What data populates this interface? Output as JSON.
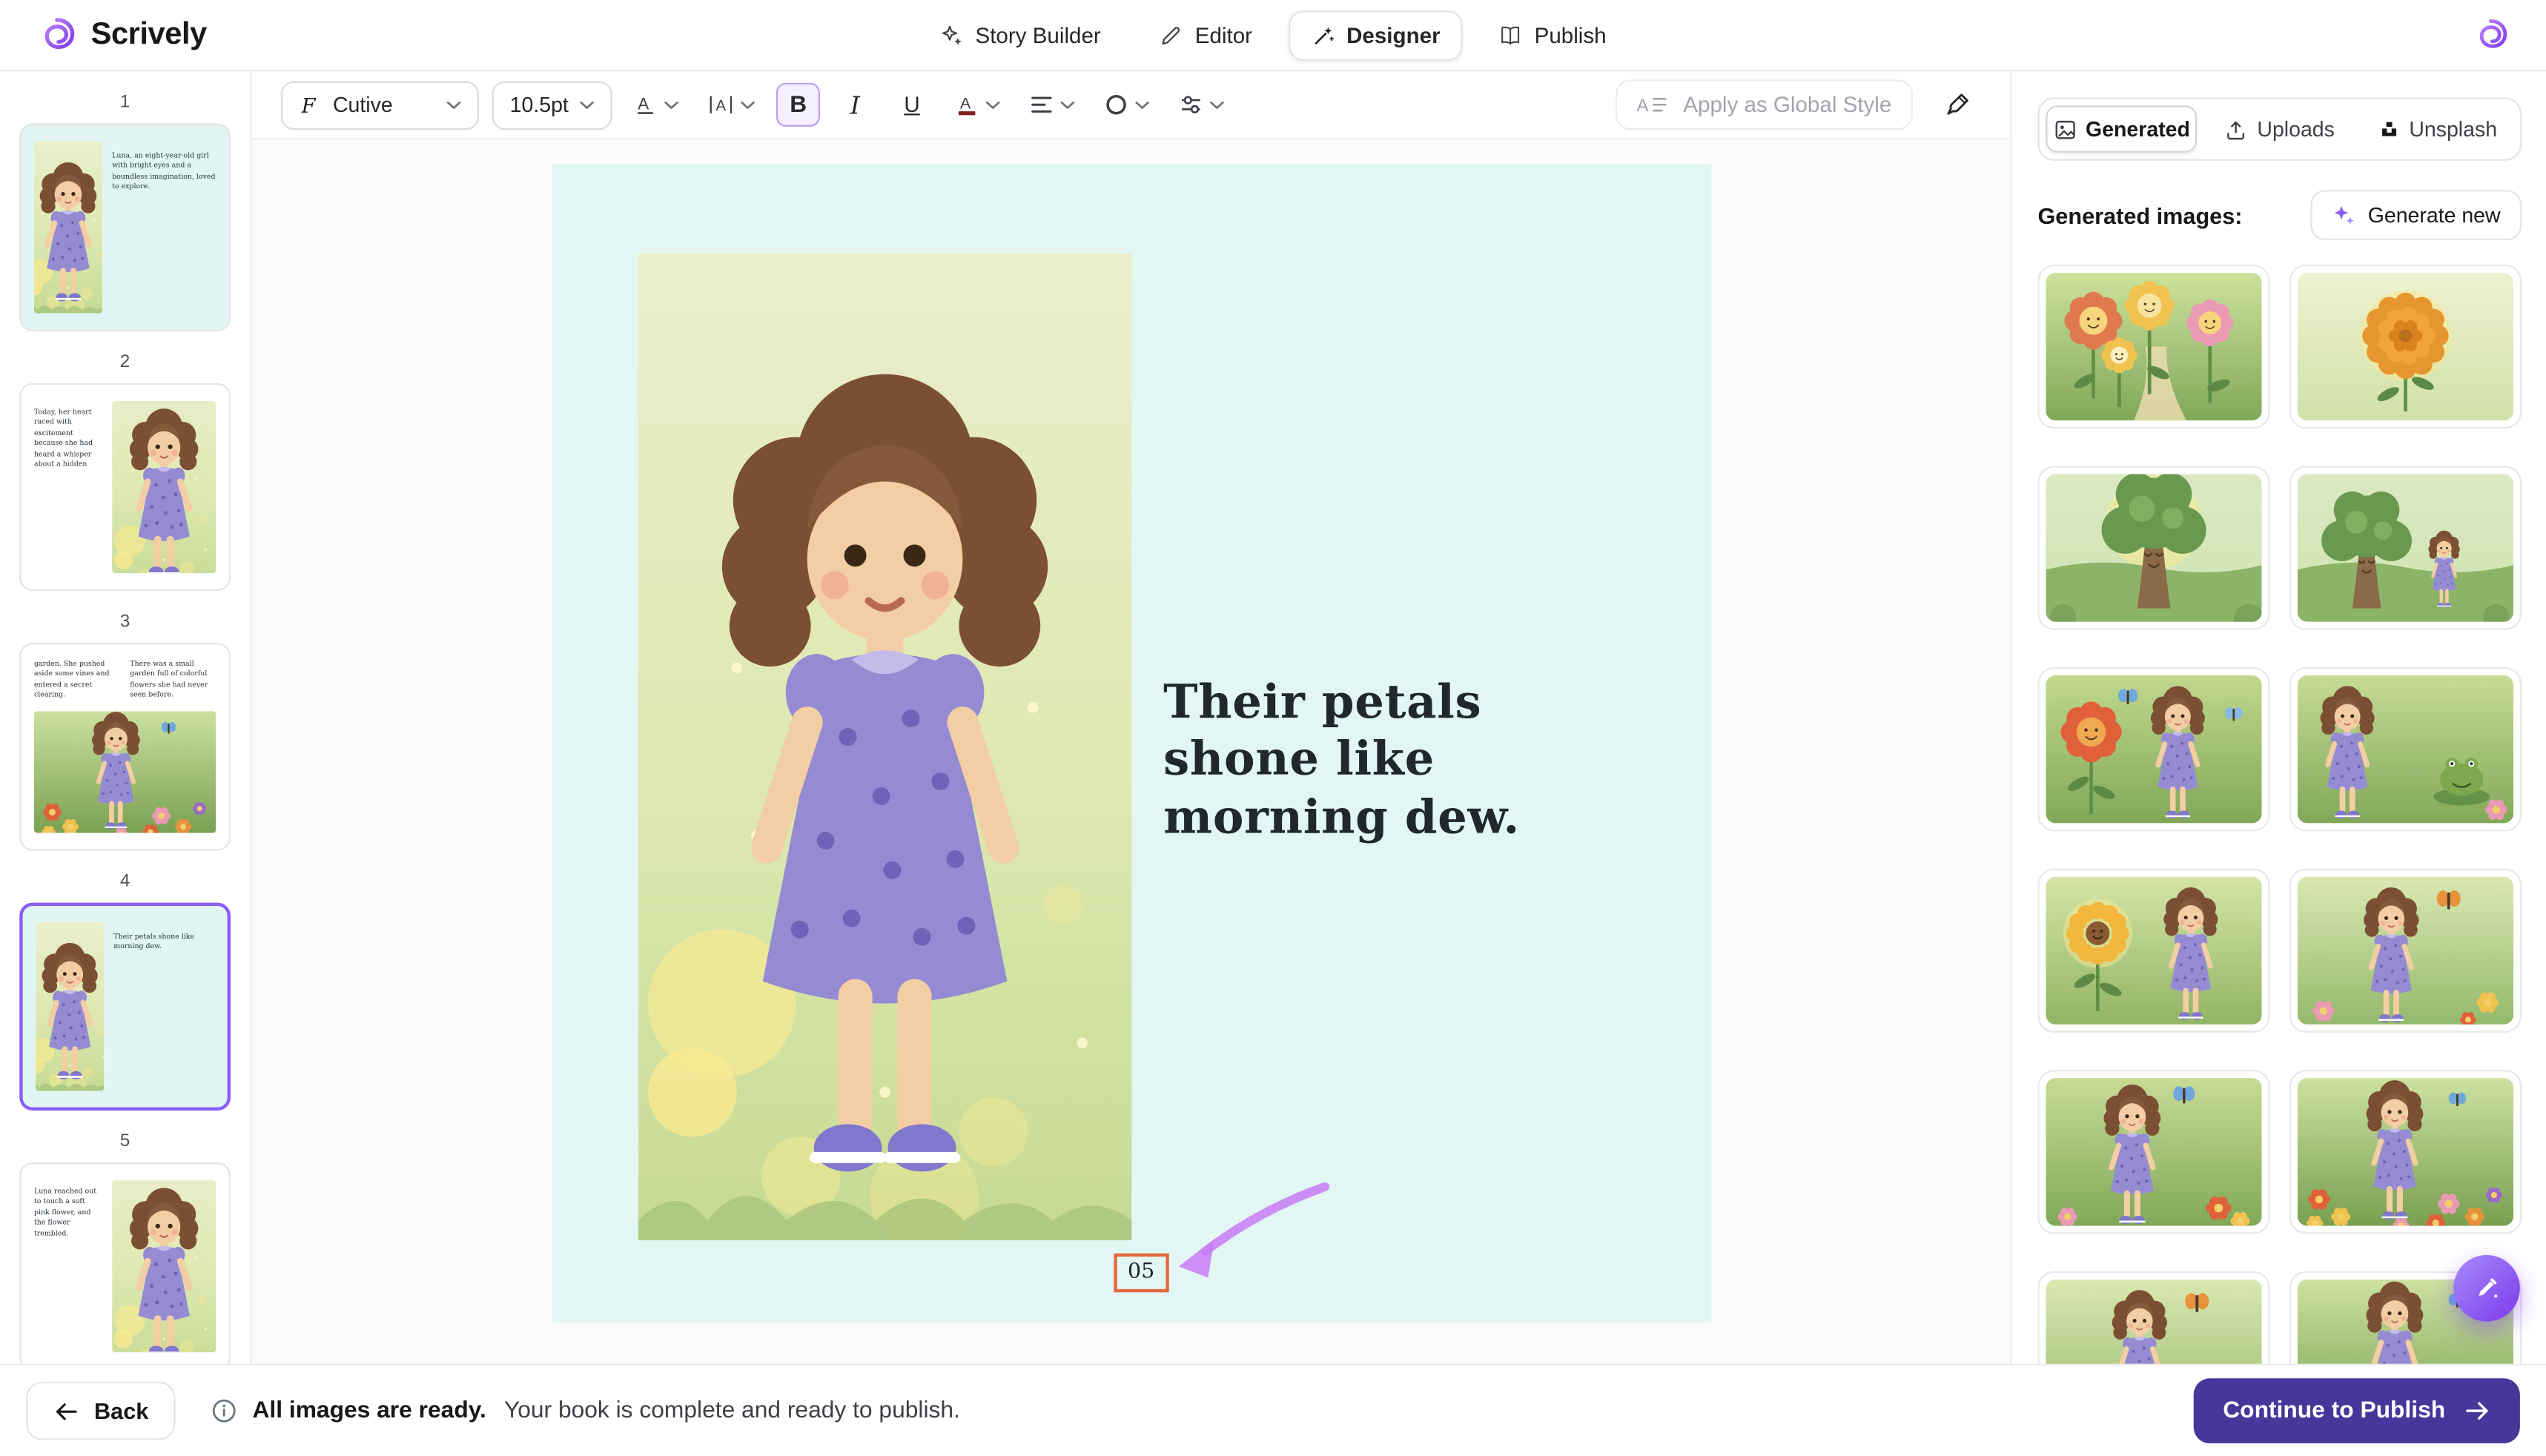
{
  "brand": {
    "name": "Scrively"
  },
  "topnav": {
    "tabs": [
      {
        "label": "Story Builder"
      },
      {
        "label": "Editor"
      },
      {
        "label": "Designer",
        "active": true
      },
      {
        "label": "Publish"
      }
    ]
  },
  "toolbar": {
    "font_name": "Cutive",
    "font_size": "10.5pt",
    "bold_label": "B",
    "italic_label": "I",
    "underline_label": "U",
    "apply_global_label": "Apply as Global Style"
  },
  "sidebar": {
    "pages": [
      {
        "number": "1",
        "text": "Luna, an eight-year-old girl with bright eyes and a boundless imagination, loved to explore.",
        "scene": "girl-portrait"
      },
      {
        "number": "2",
        "text": "Today, her heart raced with excitement because she had heard a whisper about a hidden",
        "scene": "girl-portrait"
      },
      {
        "number": "3",
        "text": "garden. She pushed aside some vines and entered a secret clearing.",
        "text2": "There was a small garden full of colorful flowers she had never seen before.",
        "scene": "girl-field"
      },
      {
        "number": "4",
        "text": "Their petals shone like morning dew.",
        "scene": "girl-portrait",
        "selected": true
      },
      {
        "number": "5",
        "text": "Luna reached out to touch a soft pink flower, and the flower trembled.",
        "scene": "girl-portrait"
      }
    ]
  },
  "canvas": {
    "page_text": "Their petals shone like morning dew.",
    "page_number": "05",
    "scene": "girl-portrait-large"
  },
  "images_panel": {
    "tabs": [
      {
        "label": "Generated",
        "active": true
      },
      {
        "label": "Uploads"
      },
      {
        "label": "Unsplash"
      }
    ],
    "header": "Generated images:",
    "generate_button": "Generate new",
    "images": [
      {
        "scene": "flowers-faces"
      },
      {
        "scene": "marigold"
      },
      {
        "scene": "tree-face"
      },
      {
        "scene": "tree-girl"
      },
      {
        "scene": "girl-red-flower"
      },
      {
        "scene": "girl-frog"
      },
      {
        "scene": "girl-sunflower"
      },
      {
        "scene": "girl-butterfly"
      },
      {
        "scene": "girl-pose"
      },
      {
        "scene": "girl-field"
      },
      {
        "scene": "girl-butterfly"
      },
      {
        "scene": "girl-field"
      }
    ]
  },
  "footer": {
    "back_label": "Back",
    "status_bold": "All images are ready.",
    "status_text": "Your book is complete and ready to publish.",
    "continue_label": "Continue to Publish"
  },
  "icons": {
    "logo": "swirl",
    "story_builder": "sparkles",
    "editor": "pen",
    "designer": "wand",
    "publish": "book",
    "generated_tab": "image",
    "uploads_tab": "upload-tray",
    "unsplash_tab": "unsplash-logo",
    "generate_new": "sparkles",
    "back": "arrow-left",
    "continue": "arrow-right",
    "status": "info-circle",
    "fab": "pen-sparkle"
  },
  "colors": {
    "accent": "#7c3aed",
    "page_bg": "#e2f6f3",
    "selection_outline": "#e2683f",
    "annotation_arrow": "#c87ef5",
    "continue_bg": "#46379b"
  }
}
